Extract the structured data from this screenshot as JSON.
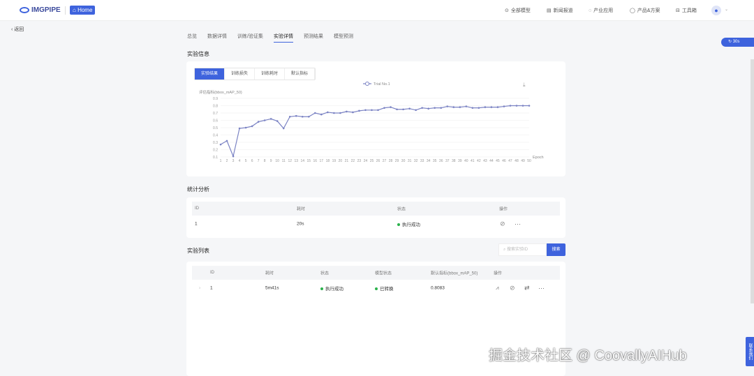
{
  "header": {
    "logo": "IMGPIPE",
    "home": "Home",
    "nav": [
      {
        "icon": "model-icon",
        "label": "全部模型"
      },
      {
        "icon": "news-icon",
        "label": "新闻报道"
      },
      {
        "icon": "bell-icon",
        "label": "产业应用"
      },
      {
        "icon": "location-icon",
        "label": "产品&方案"
      },
      {
        "icon": "toolbox-icon",
        "label": "工具箱"
      }
    ]
  },
  "back": "返回",
  "tabs": [
    "总览",
    "数据详情",
    "训练/验证集",
    "实验详情",
    "预测结果",
    "模型预测"
  ],
  "refresh": "30s",
  "section1": {
    "title": "实验信息",
    "subtabs": [
      "实验结果",
      "训练损失",
      "训练耗时",
      "默认指标"
    ]
  },
  "chart_data": {
    "type": "line",
    "ylabel": "评估指标(bbox_mAP_50)",
    "xlabel": "Epoch",
    "ylim": [
      0.1,
      0.9
    ],
    "yticks": [
      "0.1",
      "0.2",
      "0.3",
      "0.4",
      "0.5",
      "0.6",
      "0.7",
      "0.8",
      "0.9"
    ],
    "legend": "Trial No.1",
    "legend_position": "top-center",
    "x": [
      1,
      2,
      3,
      4,
      5,
      6,
      7,
      8,
      9,
      10,
      11,
      12,
      13,
      14,
      15,
      16,
      17,
      18,
      19,
      20,
      21,
      22,
      23,
      24,
      25,
      26,
      27,
      28,
      29,
      30,
      31,
      32,
      33,
      34,
      35,
      36,
      37,
      38,
      39,
      40,
      41,
      42,
      43,
      44,
      45,
      46,
      47,
      48,
      49,
      50
    ],
    "series": [
      {
        "name": "Trial No.1",
        "values": [
          0.27,
          0.32,
          0.11,
          0.49,
          0.5,
          0.52,
          0.58,
          0.6,
          0.62,
          0.59,
          0.49,
          0.65,
          0.66,
          0.65,
          0.65,
          0.7,
          0.68,
          0.71,
          0.7,
          0.7,
          0.72,
          0.71,
          0.73,
          0.74,
          0.74,
          0.74,
          0.77,
          0.78,
          0.75,
          0.75,
          0.76,
          0.74,
          0.77,
          0.76,
          0.77,
          0.77,
          0.79,
          0.78,
          0.78,
          0.79,
          0.77,
          0.77,
          0.78,
          0.78,
          0.78,
          0.79,
          0.8,
          0.8,
          0.8,
          0.8
        ]
      }
    ],
    "color": "#7b83c4"
  },
  "section2": {
    "title": "统计分析",
    "columns": [
      "ID",
      "耗时",
      "状态",
      "操作"
    ],
    "row": {
      "id": "1",
      "time": "20s",
      "status": "执行成功"
    }
  },
  "section3": {
    "title": "实验列表",
    "search_placeholder": "搜索实验ID",
    "search_btn": "搜索",
    "columns": [
      "ID",
      "耗时",
      "状态",
      "模型状态",
      "默认指标(bbox_mAP_50)",
      "操作"
    ],
    "row": {
      "id": "1",
      "time": "5m41s",
      "status": "执行成功",
      "model_status": "已转换",
      "metric": "0.8083"
    }
  },
  "side_tab": "联系我们",
  "watermark": "掘金技术社区 @ CoovallyAIHub"
}
